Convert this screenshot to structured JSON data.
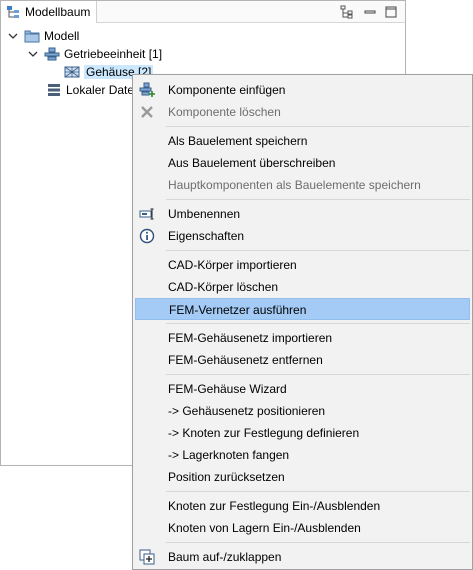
{
  "panel": {
    "title": "Modellbaum",
    "header_icons": [
      "tree-view-icon",
      "minimize-icon",
      "maximize-icon"
    ]
  },
  "tree": {
    "root": {
      "label": "Modell",
      "icon": "folder-icon"
    },
    "gear_unit": {
      "label": "Getriebeeinheit [1]",
      "icon": "gear-unit-icon"
    },
    "housing": {
      "label": "Gehäuse [2]",
      "icon": "housing-icon"
    },
    "local_data": {
      "label": "Lokaler Daten",
      "icon": "database-icon"
    }
  },
  "menu": {
    "items": [
      {
        "label": "Komponente einfügen",
        "icon": "add-component-icon",
        "enabled": true
      },
      {
        "label": "Komponente löschen",
        "icon": "delete-x-icon",
        "enabled": false
      },
      {
        "label": "Als Bauelement speichern",
        "enabled": true
      },
      {
        "label": "Aus Bauelement überschreiben",
        "enabled": true
      },
      {
        "label": "Hauptkomponenten als Bauelemente speichern",
        "enabled": false
      },
      {
        "label": "Umbenennen",
        "icon": "rename-icon",
        "enabled": true
      },
      {
        "label": "Eigenschaften",
        "icon": "info-icon",
        "enabled": true
      },
      {
        "label": "CAD-Körper importieren",
        "enabled": true
      },
      {
        "label": "CAD-Körper löschen",
        "enabled": true
      },
      {
        "label": "FEM-Vernetzer ausführen",
        "enabled": true,
        "highlighted": true
      },
      {
        "label": "FEM-Gehäusenetz importieren",
        "enabled": true
      },
      {
        "label": "FEM-Gehäusenetz entfernen",
        "enabled": true
      },
      {
        "label": "FEM-Gehäuse Wizard",
        "enabled": true
      },
      {
        "label": "->  Gehäusenetz positionieren",
        "enabled": true
      },
      {
        "label": "->  Knoten zur Festlegung definieren",
        "enabled": true
      },
      {
        "label": "->  Lagerknoten fangen",
        "enabled": true
      },
      {
        "label": "Position zurücksetzen",
        "enabled": true
      },
      {
        "label": "Knoten zur Festlegung Ein-/Ausblenden",
        "enabled": true
      },
      {
        "label": "Knoten von Lagern Ein-/Ausblenden",
        "enabled": true
      },
      {
        "label": "Baum auf-/zuklappen",
        "icon": "expand-tree-icon",
        "enabled": true
      }
    ]
  },
  "colors": {
    "highlight": "#a3cbf5",
    "selection": "#cce8ff",
    "menu_bg": "#f2f2f2",
    "disabled_text": "#6d6d6d"
  }
}
